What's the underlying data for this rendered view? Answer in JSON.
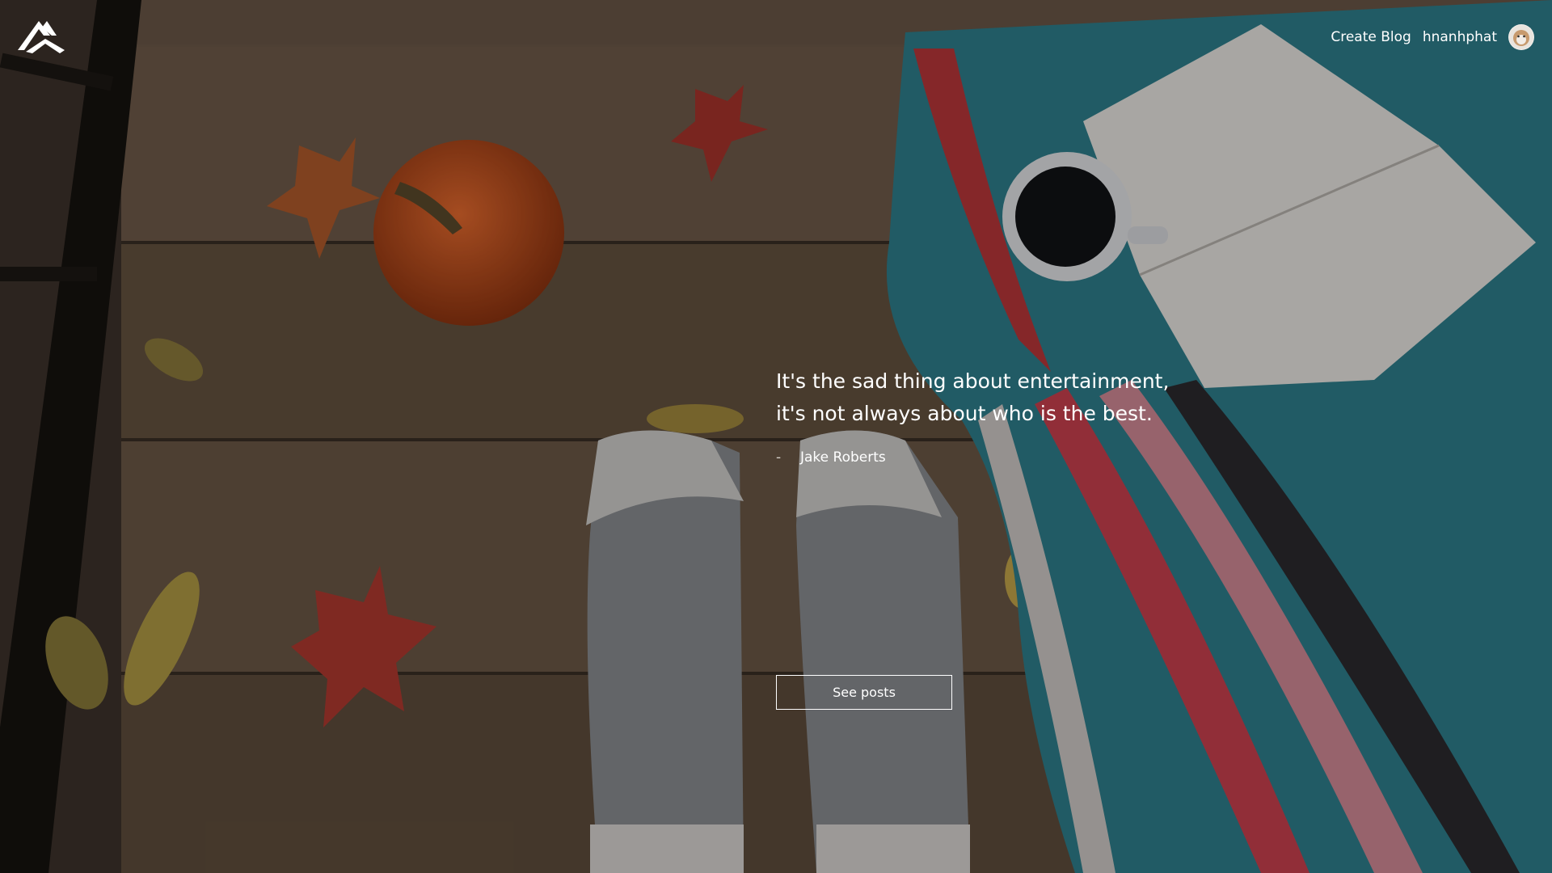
{
  "header": {
    "logo_icon": "mountain-logo-icon",
    "nav": {
      "create_blog": "Create Blog",
      "username": "hnanhphat",
      "avatar_icon": "user-avatar-icon"
    }
  },
  "hero": {
    "quote": "It's the sad thing about entertainment, it's not always about who is the best.",
    "author_dash": "-",
    "author": "Jake Roberts",
    "button": "See posts",
    "background_image": "wooden-porch-pumpkin-socks-blanket-book-coffee"
  },
  "colors": {
    "text": "#ffffff",
    "button_border": "#ffffff"
  }
}
